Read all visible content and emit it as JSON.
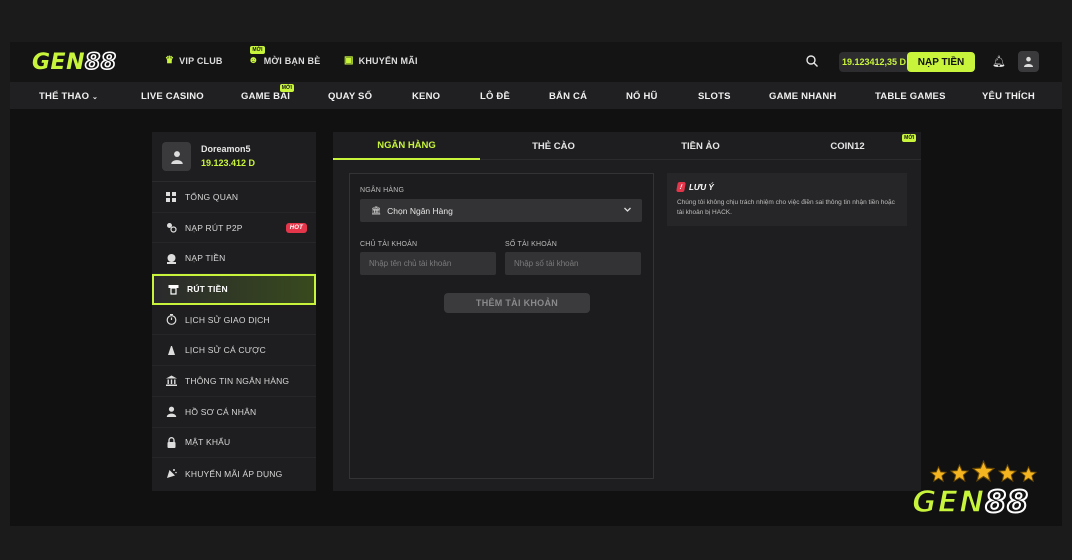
{
  "logo": {
    "main": "GEN",
    "num": "88"
  },
  "header": {
    "links": [
      {
        "label": "VIP CLUB",
        "icon": "crown-icon",
        "badge": ""
      },
      {
        "label": "MỜI BẠN BÈ",
        "icon": "friends-icon",
        "badge": "MỚI"
      },
      {
        "label": "KHUYẾN MÃI",
        "icon": "gift-icon",
        "badge": ""
      }
    ],
    "balance": "19.123412,35 D",
    "deposit_label": "NẠP TIỀN"
  },
  "categories": [
    {
      "label": "THỂ THAO",
      "badge": ""
    },
    {
      "label": "LIVE CASINO",
      "badge": ""
    },
    {
      "label": "GAME BÀI",
      "badge": "MỚI"
    },
    {
      "label": "QUAY SỐ",
      "badge": ""
    },
    {
      "label": "KENO",
      "badge": ""
    },
    {
      "label": "LÔ ĐỀ",
      "badge": ""
    },
    {
      "label": "BẮN CÁ",
      "badge": ""
    },
    {
      "label": "NỔ HŨ",
      "badge": ""
    },
    {
      "label": "SLOTS",
      "badge": ""
    },
    {
      "label": "GAME NHANH",
      "badge": ""
    },
    {
      "label": "TABLE GAMES",
      "badge": ""
    },
    {
      "label": "YÊU THÍCH",
      "badge": ""
    }
  ],
  "profile": {
    "username": "Doreamon5",
    "balance": "19.123.412 D"
  },
  "sidebar": {
    "items": [
      {
        "label": "TỔNG QUAN",
        "icon": "grid-icon",
        "badge": ""
      },
      {
        "label": "NẠP RÚT P2P",
        "icon": "p2p-icon",
        "badge": "HOT"
      },
      {
        "label": "NẠP TIỀN",
        "icon": "deposit-icon",
        "badge": ""
      },
      {
        "label": "RÚT TIỀN",
        "icon": "withdraw-icon",
        "badge": "",
        "active": true
      },
      {
        "label": "LỊCH SỬ GIAO DỊCH",
        "icon": "history-icon",
        "badge": ""
      },
      {
        "label": "LỊCH SỬ CÁ CƯỢC",
        "icon": "bet-history-icon",
        "badge": ""
      },
      {
        "label": "THÔNG TIN NGÂN HÀNG",
        "icon": "bank-icon",
        "badge": ""
      },
      {
        "label": "HỒ SƠ CÁ NHÂN",
        "icon": "person-icon",
        "badge": ""
      },
      {
        "label": "MẬT KHẨU",
        "icon": "lock-icon",
        "badge": ""
      },
      {
        "label": "KHUYẾN MÃI ÁP DỤNG",
        "icon": "promo-icon",
        "badge": ""
      }
    ]
  },
  "tabs": [
    {
      "label": "NGÂN HÀNG",
      "active": true,
      "badge": ""
    },
    {
      "label": "THẺ CÀO",
      "active": false,
      "badge": ""
    },
    {
      "label": "TIỀN ẢO",
      "active": false,
      "badge": ""
    },
    {
      "label": "COIN12",
      "active": false,
      "badge": "MỚI"
    }
  ],
  "form": {
    "bank_label": "NGÂN HÀNG",
    "bank_select": "Chọn Ngân Hàng",
    "holder_label": "CHỦ TÀI KHOẢN",
    "holder_placeholder": "Nhập tên chủ tài khoản",
    "number_label": "SỐ TÀI KHOẢN",
    "number_placeholder": "Nhập số tài khoản",
    "submit_label": "THÊM TÀI KHOẢN"
  },
  "note": {
    "mark": "!",
    "title": "LƯU Ý",
    "text": "Chúng tôi không chịu trách nhiệm cho việc điền sai thông tin nhận tiền hoặc tài khoản bị HACK."
  },
  "colors": {
    "accent": "#c8f53c",
    "hot": "#e4364a",
    "panel": "#1e1e20"
  }
}
